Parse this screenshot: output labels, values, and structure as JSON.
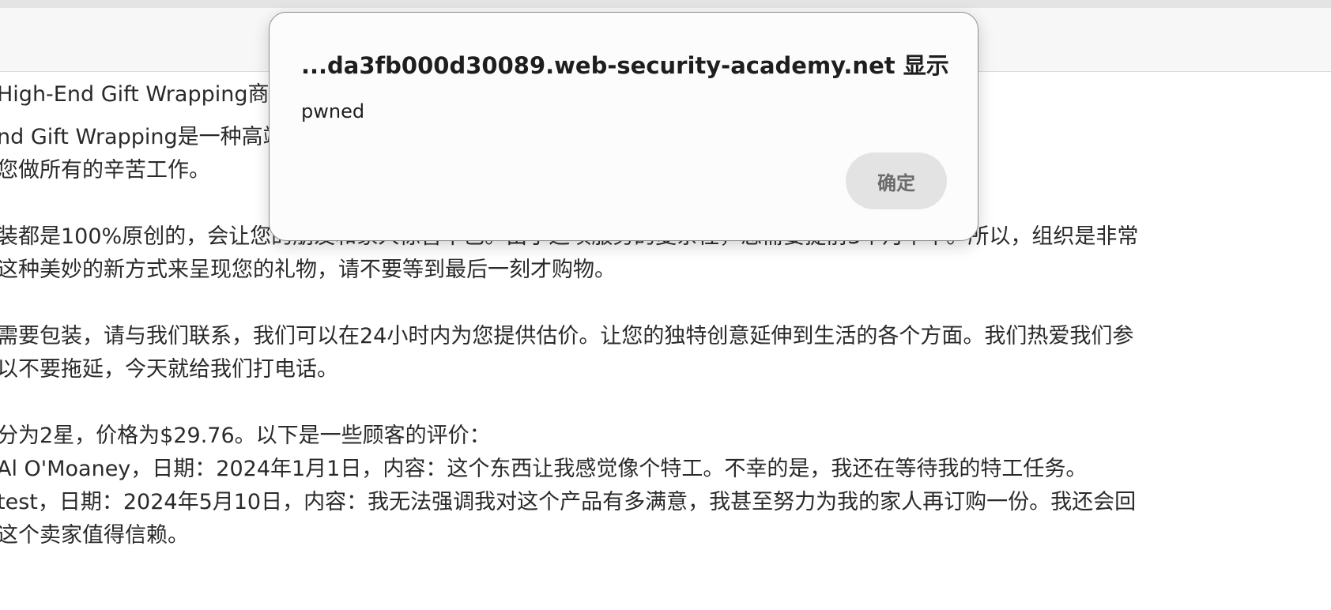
{
  "page": {
    "lines": [
      "High-End Gift Wrapping商品描述",
      "nd Gift Wrapping是一种高端礼品包装服务，我们可以根据您的要求编织任何形状和尺寸。我们这",
      "您做所有的辛苦工作。",
      "装都是100%原创的，会让您的朋友和家人惊喜不已。由于这项服务的复杂性，您需要提前3个月下单。所以，组织是非常",
      "这种美妙的新方式来呈现您的礼物，请不要等到最后一刻才购物。",
      "需要包装，请与我们联系，我们可以在24小时内为您提供估价。让您的独特创意延伸到生活的各个方面。我们热爱我们参",
      "以不要拖延，今天就给我们打电话。",
      "分为2星，价格为$29.76。以下是一些顾客的评价：",
      " Al O'Moaney，日期：2024年1月1日，内容：这个东西让我感觉像个特工。不幸的是，我还在等待我的特工任务。",
      " test，日期：2024年5月10日，内容：我无法强调我对这个产品有多满意，我甚至努力为我的家人再订购一份。我还会回",
      "这个卖家值得信赖。"
    ]
  },
  "dialog": {
    "title": "...da3fb000d30089.web-security-academy.net 显示",
    "message": "pwned",
    "ok_label": "确定"
  }
}
